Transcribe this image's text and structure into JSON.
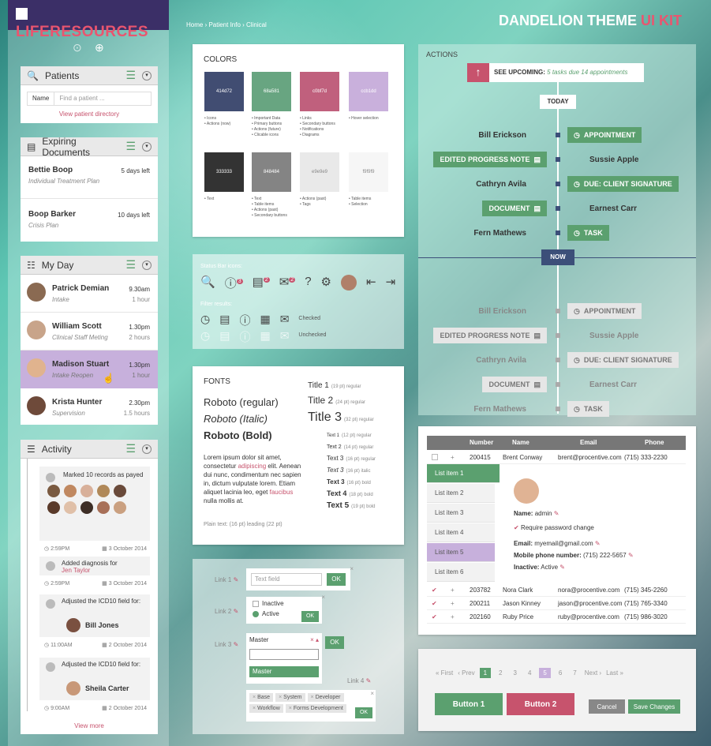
{
  "app": {
    "logo": "LIFERESOURCES",
    "breadcrumb": "Home › Patient Info › Clinical",
    "kit_title_a": "DANDELION THEME",
    "kit_title_b": "UI KIT"
  },
  "patients": {
    "title": "Patients",
    "select": "Name",
    "placeholder": "Find a patient ...",
    "link": "View patient directory"
  },
  "expiring": {
    "title": "Expiring Documents",
    "items": [
      {
        "name": "Bettie Boop",
        "sub": "Individual Treatment Plan",
        "time": "5 days left"
      },
      {
        "name": "Boop Barker",
        "sub": "Crisis Plan",
        "time": "10 days left"
      }
    ]
  },
  "myday": {
    "title": "My Day",
    "items": [
      {
        "name": "Patrick Demian",
        "sub": "Intake",
        "time": "9.30am",
        "dur": "1 hour"
      },
      {
        "name": "William Scott",
        "sub": "Clinical Staff Meting",
        "time": "1.30pm",
        "dur": "2 hours"
      },
      {
        "name": "Madison Stuart",
        "sub": "Intake Reopen",
        "time": "1.30pm",
        "dur": "1 hour"
      },
      {
        "name": "Krista Hunter",
        "sub": "Supervision",
        "time": "2.30pm",
        "dur": "1.5 hours"
      }
    ]
  },
  "activity": {
    "title": "Activity",
    "items": [
      {
        "text": "Marked 10 records as payed",
        "time": "2:59PM",
        "date": "3 October 2014"
      },
      {
        "text": "Added diagnosis for",
        "link": "Jen Taylor",
        "time": "2:59PM",
        "date": "3 October 2014"
      },
      {
        "text": "Adjusted the ICD10 field for:",
        "person": "Bill Jones",
        "time": "11:00AM",
        "date": "2 October 2014"
      },
      {
        "text": "Adjusted the ICD10 field for:",
        "person": "Sheila Carter",
        "time": "9:00AM",
        "date": "2 October 2014"
      }
    ],
    "more": "View more"
  },
  "colors": {
    "title": "COLORS",
    "swatches": [
      {
        "hex": "414d72",
        "color": "#414d72",
        "notes": "• Icons\n• Actions (now)"
      },
      {
        "hex": "68a581",
        "color": "#68a581",
        "notes": "• Important Data\n• Primary buttons\n• Actions (future)\n• Clicable icons"
      },
      {
        "hex": "c0bf7d",
        "color": "#c0607d",
        "notes": "• Links\n• Secondary buttons\n• Notifications\n• Diagrams"
      },
      {
        "hex": "ccb1dd",
        "color": "#c9b0dc",
        "notes": "• Hover selection"
      },
      {
        "hex": "333333",
        "color": "#333333",
        "notes": "• Text"
      },
      {
        "hex": "848484",
        "color": "#848484",
        "notes": "• Text\n• Table items\n• Actions (past)\n• Secondary buttons"
      },
      {
        "hex": "e9e9e9",
        "color": "#e9e9e9",
        "notes": "• Actions (past)\n• Tags"
      },
      {
        "hex": "f9f9f9",
        "color": "#f6f6f6",
        "notes": "• Table items\n• Selection"
      }
    ]
  },
  "status": {
    "title": "Status Bar icons:",
    "filter": "Filter results:",
    "checked": "Checked",
    "unchecked": "Unchecked",
    "badges": [
      "3",
      "2",
      "2"
    ]
  },
  "fonts": {
    "title": "FONTS",
    "reg": "Roboto (regular)",
    "ital": "Roboto (Italic)",
    "bold": "Roboto (Bold)",
    "lorem1": "Lorem ipsum dolor sit amet, consectetur",
    "lorem_link1": "adipiscing",
    "lorem2": "elit. Aenean dui nunc, condimentum nec sapien in, dictum vulputate lorem. Etiam aliquet lacinia leo, eget",
    "lorem_link2": "faucibus",
    "lorem3": "nulla mollis at.",
    "plain": "Plain text: (16 pt) leading (22 pt)",
    "titles": [
      {
        "t": "Title 1",
        "s": "(19 pt) regular"
      },
      {
        "t": "Title 2",
        "s": "(24 pt) regular"
      },
      {
        "t": "Title 3",
        "s": "(32 pt) regular"
      }
    ],
    "texts": [
      {
        "t": "Text 1",
        "s": "(12 pt) regular"
      },
      {
        "t": "Text 2",
        "s": "(14 pt) regular"
      },
      {
        "t": "Text 3",
        "s": "(16 pt) regular"
      },
      {
        "t": "Text 3",
        "s": "(16 pt) italic"
      },
      {
        "t": "Text 3",
        "s": "(16 pt) bold"
      },
      {
        "t": "Text 4",
        "s": "(18 pt) bold"
      },
      {
        "t": "Text 5",
        "s": "(19 pt) bold"
      }
    ]
  },
  "forms": {
    "link1": "Link 1",
    "link2": "Link 2",
    "link3": "Link 3",
    "link4": "Link 4",
    "text_field": "Text field",
    "ok": "OK",
    "inactive": "Inactive",
    "active": "Active",
    "master": "Master",
    "tags": [
      "Base",
      "System",
      "Developer",
      "Workflow",
      "Forms Development"
    ]
  },
  "actions": {
    "title": "ACTIONS",
    "upcoming": "SEE UPCOMING:",
    "tasks": "5 tasks due",
    "appts": "14 appointments",
    "today": "TODAY",
    "now": "NOW",
    "rows": [
      {
        "left": "Bill Erickson",
        "right": "APPOINTMENT"
      },
      {
        "left": "EDITED PROGRESS NOTE",
        "right": "Sussie Apple"
      },
      {
        "left": "Cathryn Avila",
        "right": "DUE: CLIENT SIGNATURE"
      },
      {
        "left": "DOCUMENT",
        "right": "Earnest Carr"
      },
      {
        "left": "Fern Mathews",
        "right": "TASK"
      }
    ]
  },
  "table": {
    "cols": [
      "Number",
      "Name",
      "Email",
      "Phone"
    ],
    "rows": [
      {
        "num": "200415",
        "name": "Brent Conway",
        "email": "brent@procentive.com",
        "phone": "(715) 333-2230"
      },
      {
        "num": "203782",
        "name": "Nora Clark",
        "email": "nora@procentive.com",
        "phone": "(715) 345-2260"
      },
      {
        "num": "200211",
        "name": "Jason Kinney",
        "email": "jason@procentive.com",
        "phone": "(715) 765-3340"
      },
      {
        "num": "202160",
        "name": "Ruby Price",
        "email": "ruby@procentive.com",
        "phone": "(715) 986-3020"
      }
    ],
    "list": [
      "List item 1",
      "List item 2",
      "List item 3",
      "List item 4",
      "List item 5",
      "List item 6"
    ],
    "detail": {
      "name_l": "Name:",
      "name_v": "admin",
      "req": "Require password change",
      "email_l": "Email:",
      "email_v": "myemail@gmail.com",
      "phone_l": "Mobile phone number:",
      "phone_v": "(715) 222-5657",
      "inactive_l": "Inactive:",
      "inactive_v": "Active"
    }
  },
  "pager": {
    "first": "« First",
    "prev": "‹ Prev",
    "pages": [
      "1",
      "2",
      "3",
      "4",
      "5",
      "6",
      "7"
    ],
    "next": "Next ›",
    "last": "Last »",
    "b1": "Button 1",
    "b2": "Button 2",
    "cancel": "Cancel",
    "save": "Save Changes"
  }
}
